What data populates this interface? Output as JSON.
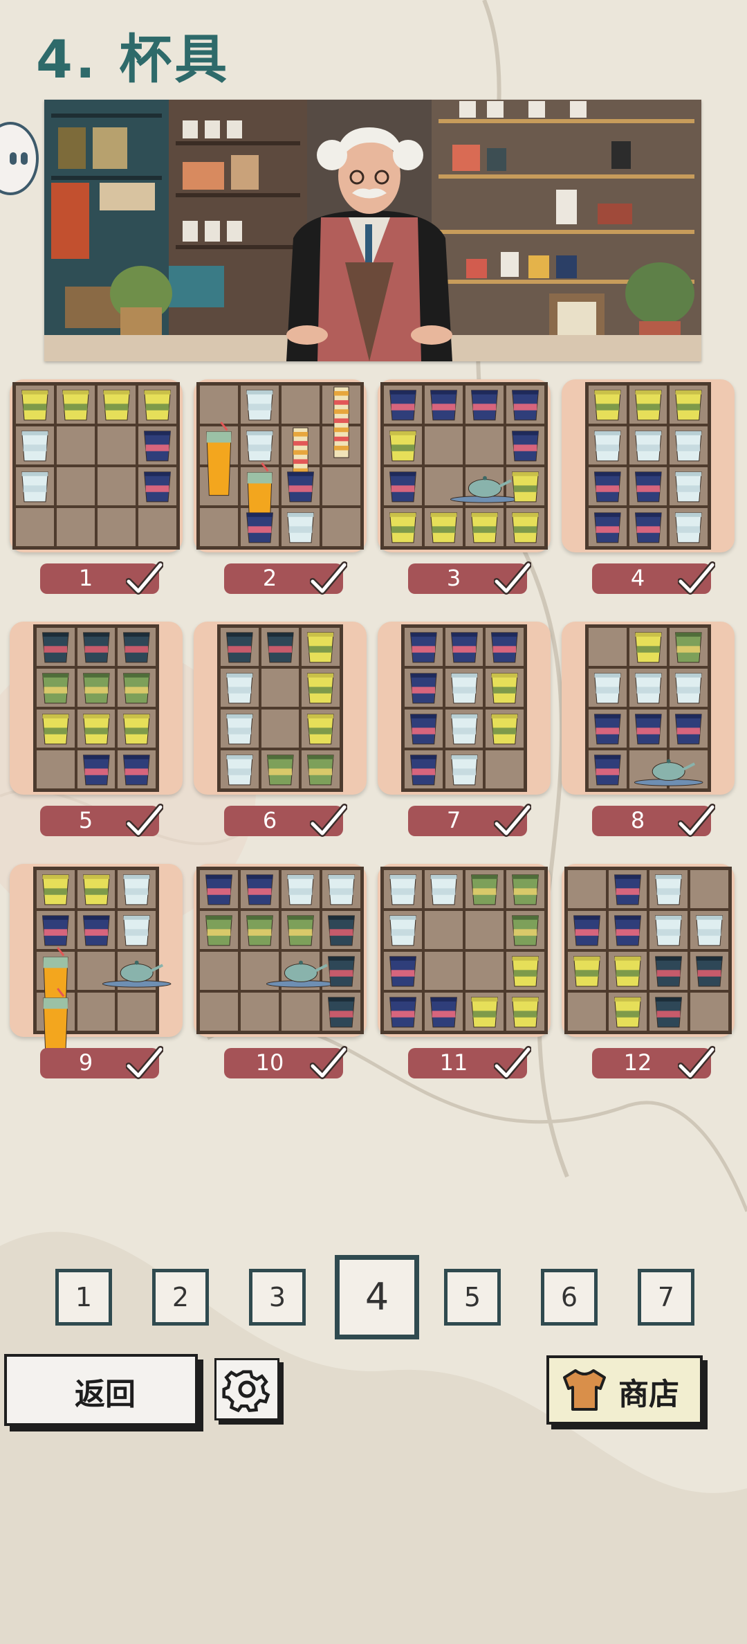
{
  "header": {
    "title": "4. 杯具"
  },
  "levels": [
    {
      "number": "1",
      "completed": true
    },
    {
      "number": "2",
      "completed": true
    },
    {
      "number": "3",
      "completed": true
    },
    {
      "number": "4",
      "completed": true
    },
    {
      "number": "5",
      "completed": true
    },
    {
      "number": "6",
      "completed": true
    },
    {
      "number": "7",
      "completed": true
    },
    {
      "number": "8",
      "completed": true
    },
    {
      "number": "9",
      "completed": true
    },
    {
      "number": "10",
      "completed": true
    },
    {
      "number": "11",
      "completed": true
    },
    {
      "number": "12",
      "completed": true
    }
  ],
  "pager": {
    "pages": [
      "1",
      "2",
      "3",
      "4",
      "5",
      "6",
      "7"
    ],
    "current": "4"
  },
  "buttons": {
    "back": "返回",
    "shop": "商店"
  },
  "icons": {
    "settings": "gear-icon",
    "shop": "shirt-icon",
    "check": "check-icon"
  },
  "colors": {
    "accent": "#2e6a6a",
    "badge": "#a55357",
    "card": "#efc9b1",
    "shop_bg": "#f2eed0",
    "shirt": "#d98f4a"
  }
}
